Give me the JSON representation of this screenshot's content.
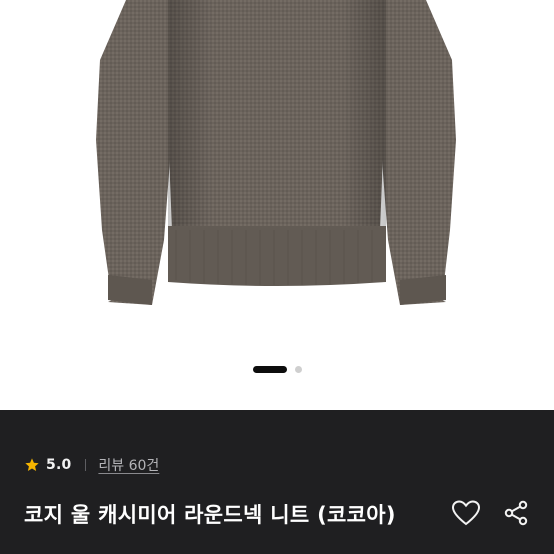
{
  "product": {
    "image_alt": "product image",
    "carousel": {
      "current": 1,
      "total": 2
    },
    "rating": {
      "value": "5.0",
      "star": "star-icon"
    },
    "review_link": "리뷰 60건",
    "title": "코지 울 캐시미어 라운드넥 니트 (코코아)",
    "actions": {
      "like": "heart-icon",
      "share": "share-icon"
    }
  },
  "colors": {
    "panel_bg": "#1f1f21",
    "star": "#f5b400",
    "sweater": "#6b625b"
  }
}
